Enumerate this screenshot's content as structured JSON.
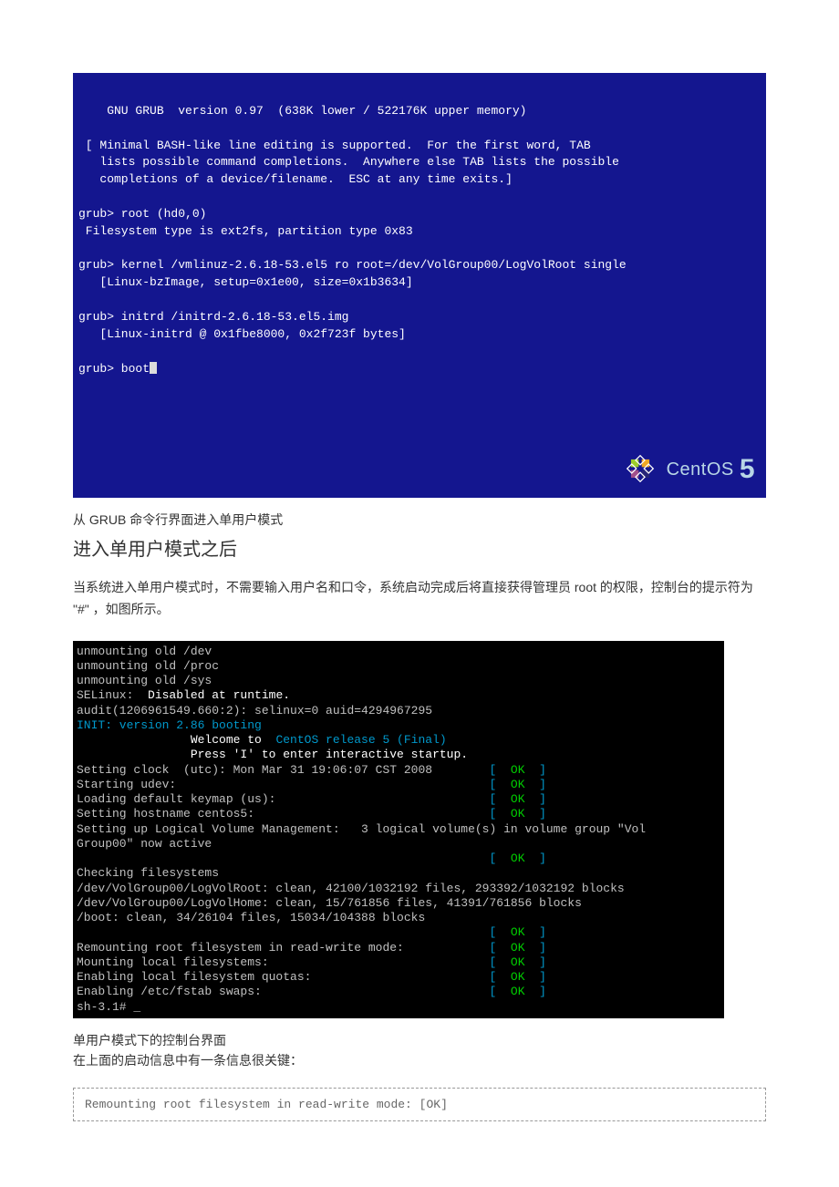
{
  "grub": {
    "header": "    GNU GRUB  version 0.97  (638K lower / 522176K upper memory)",
    "hint1": " [ Minimal BASH-like line editing is supported.  For the first word, TAB",
    "hint2": "   lists possible command completions.  Anywhere else TAB lists the possible",
    "hint3": "   completions of a device/filename.  ESC at any time exits.]",
    "l1": "grub> root (hd0,0)",
    "l2": " Filesystem type is ext2fs, partition type 0x83",
    "l3": "grub> kernel /vmlinuz-2.6.18-53.el5 ro root=/dev/VolGroup00/LogVolRoot single",
    "l4": "   [Linux-bzImage, setup=0x1e00, size=0x1b3634]",
    "l5": "grub> initrd /initrd-2.6.18-53.el5.img",
    "l6": "   [Linux-initrd @ 0x1fbe8000, 0x2f723f bytes]",
    "l7": "grub> boot",
    "logo_text": "CentOS",
    "logo_five": "5"
  },
  "doc": {
    "caption1": "从 GRUB 命令行界面进入单用户模式",
    "heading": "进入单用户模式之后",
    "para": "当系统进入单用户模式时，不需要输入用户名和口令，系统启动完成后将直接获得管理员 root 的权限，控制台的提示符为 \"#\" ，如图所示。",
    "caption2": "单用户模式下的控制台界面",
    "note": "在上面的启动信息中有一条信息很关键：",
    "code": "Remounting root filesystem in read-write mode: [OK]"
  },
  "boot": {
    "l1": "unmounting old /dev",
    "l2": "unmounting old /proc",
    "l3": "unmounting old /sys",
    "l4a": "SELinux:  ",
    "l4b": "Disabled at runtime.",
    "l5": "audit(1206961549.660:2): selinux=0 auid=4294967295",
    "l6": "INIT: version 2.86 booting",
    "l7a": "                Welcome to  ",
    "l7b": "CentOS release 5 (Final)",
    "l8": "                Press 'I' to enter interactive startup.",
    "l9a": "Setting clock  (utc): Mon Mar 31 19:06:07 CST 2008        ",
    "l10a": "Starting udev:                                            ",
    "l11a": "Loading default keymap (us):                              ",
    "l12a": "Setting hostname centos5:                                 ",
    "l13": "Setting up Logical Volume Management:   3 logical volume(s) in volume group \"Vol",
    "l14": "Group00\" now active",
    "l15a": "                                                          ",
    "l16": "Checking filesystems",
    "l17": "/dev/VolGroup00/LogVolRoot: clean, 42100/1032192 files, 293392/1032192 blocks",
    "l18": "/dev/VolGroup00/LogVolHome: clean, 15/761856 files, 41391/761856 blocks",
    "l19": "/boot: clean, 34/26104 files, 15034/104388 blocks",
    "l20a": "                                                          ",
    "l21a": "Remounting root filesystem in read-write mode:            ",
    "l22a": "Mounting local filesystems:                               ",
    "l23a": "Enabling local filesystem quotas:                         ",
    "l24a": "Enabling /etc/fstab swaps:                                ",
    "l25": "sh-3.1# _",
    "ok_open": "[  ",
    "ok": "OK",
    "ok_close": "  ]"
  }
}
